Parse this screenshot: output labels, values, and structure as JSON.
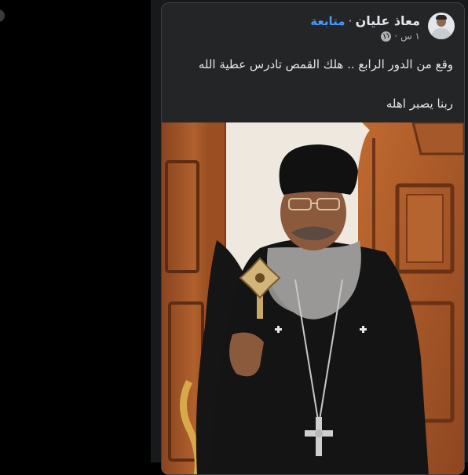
{
  "post": {
    "author_name": "معاذ عليان",
    "separator": "·",
    "follow_label": "متابعة",
    "timestamp": "١ س ·",
    "audience_icon": "globe-icon",
    "text_line_1": "وقع من الدور الرابع .. هلك القمص تادرس عطية الله",
    "text_line_2": "ربنا يصبر اهله"
  },
  "colors": {
    "card_bg": "#242526",
    "text_primary": "#e4e6eb",
    "text_secondary": "#b0b3b8",
    "follow_link": "#4599ff"
  }
}
